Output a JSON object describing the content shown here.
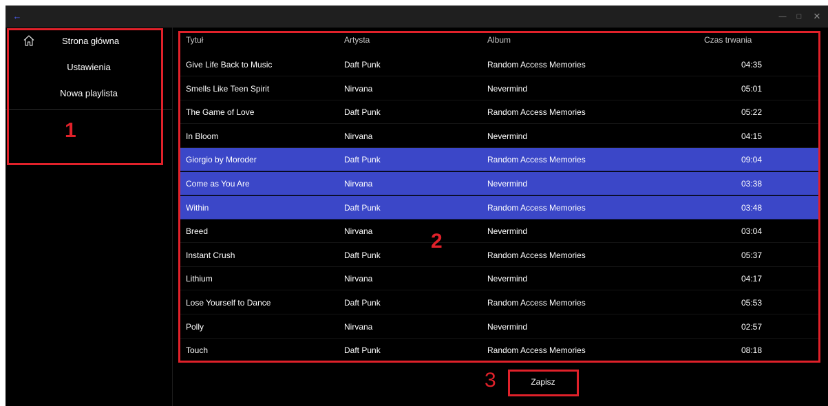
{
  "titlebar": {
    "back_icon": "arrow-left-icon",
    "controls": [
      "minimize-icon",
      "maximize-icon",
      "close-icon"
    ]
  },
  "sidebar": {
    "items": [
      {
        "label": "Strona główna",
        "icon": "home-icon"
      },
      {
        "label": "Ustawienia"
      },
      {
        "label": "Nowa playlista"
      }
    ]
  },
  "table": {
    "headers": [
      "Tytuł",
      "Artysta",
      "Album",
      "Czas trwania"
    ],
    "rows": [
      {
        "title": "Give Life Back to Music",
        "artist": "Daft Punk",
        "album": "Random Access Memories",
        "duration": "04:35",
        "selected": false
      },
      {
        "title": "Smells Like Teen Spirit",
        "artist": "Nirvana",
        "album": "Nevermind",
        "duration": "05:01",
        "selected": false
      },
      {
        "title": "The Game of Love",
        "artist": "Daft Punk",
        "album": "Random Access Memories",
        "duration": "05:22",
        "selected": false
      },
      {
        "title": "In Bloom",
        "artist": "Nirvana",
        "album": "Nevermind",
        "duration": "04:15",
        "selected": false
      },
      {
        "title": "Giorgio by Moroder",
        "artist": "Daft Punk",
        "album": "Random Access Memories",
        "duration": "09:04",
        "selected": true
      },
      {
        "title": "Come as You Are",
        "artist": "Nirvana",
        "album": "Nevermind",
        "duration": "03:38",
        "selected": true
      },
      {
        "title": "Within",
        "artist": "Daft Punk",
        "album": "Random Access Memories",
        "duration": "03:48",
        "selected": true
      },
      {
        "title": "Breed",
        "artist": "Nirvana",
        "album": "Nevermind",
        "duration": "03:04",
        "selected": false
      },
      {
        "title": "Instant Crush",
        "artist": "Daft Punk",
        "album": "Random Access Memories",
        "duration": "05:37",
        "selected": false
      },
      {
        "title": "Lithium",
        "artist": "Nirvana",
        "album": "Nevermind",
        "duration": "04:17",
        "selected": false
      },
      {
        "title": "Lose Yourself to Dance",
        "artist": "Daft Punk",
        "album": "Random Access Memories",
        "duration": "05:53",
        "selected": false
      },
      {
        "title": "Polly",
        "artist": "Nirvana",
        "album": "Nevermind",
        "duration": "02:57",
        "selected": false
      },
      {
        "title": "Touch",
        "artist": "Daft Punk",
        "album": "Random Access Memories",
        "duration": "08:18",
        "selected": false
      }
    ]
  },
  "save_label": "Zapisz",
  "annotations": [
    "1",
    "2",
    "3"
  ],
  "colors": {
    "selection": "#3b47c8",
    "annotation": "#e0212a",
    "accent": "#4a5cf0"
  }
}
